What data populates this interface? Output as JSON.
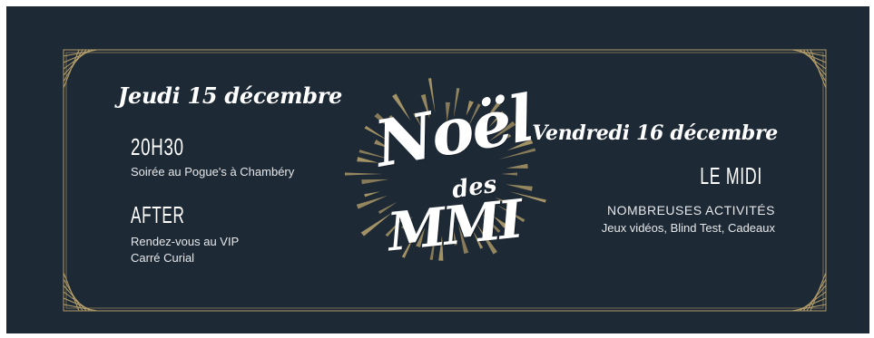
{
  "colors": {
    "background": "#1d2935",
    "gold": "#b39d6a",
    "text": "#ffffff"
  },
  "left": {
    "date": "Jeudi 15 décembre",
    "time": "20H30",
    "venue": "Soirée au Pogue's à Chambéry",
    "after_title": "AFTER",
    "after_line1": "Rendez-vous au VIP",
    "after_line2": "Carré Curial"
  },
  "center": {
    "logo_line1": "Noël",
    "logo_line2": "des",
    "logo_line3": "MMI",
    "logo_icons": [
      "sunburst-icon"
    ]
  },
  "right": {
    "date": "Vendredi 16 décembre",
    "time": "LE MIDI",
    "activities_title": "NOMBREUSES ACTIVITÉS",
    "activities_list": "Jeux vidéos, Blind Test, Cadeaux"
  }
}
